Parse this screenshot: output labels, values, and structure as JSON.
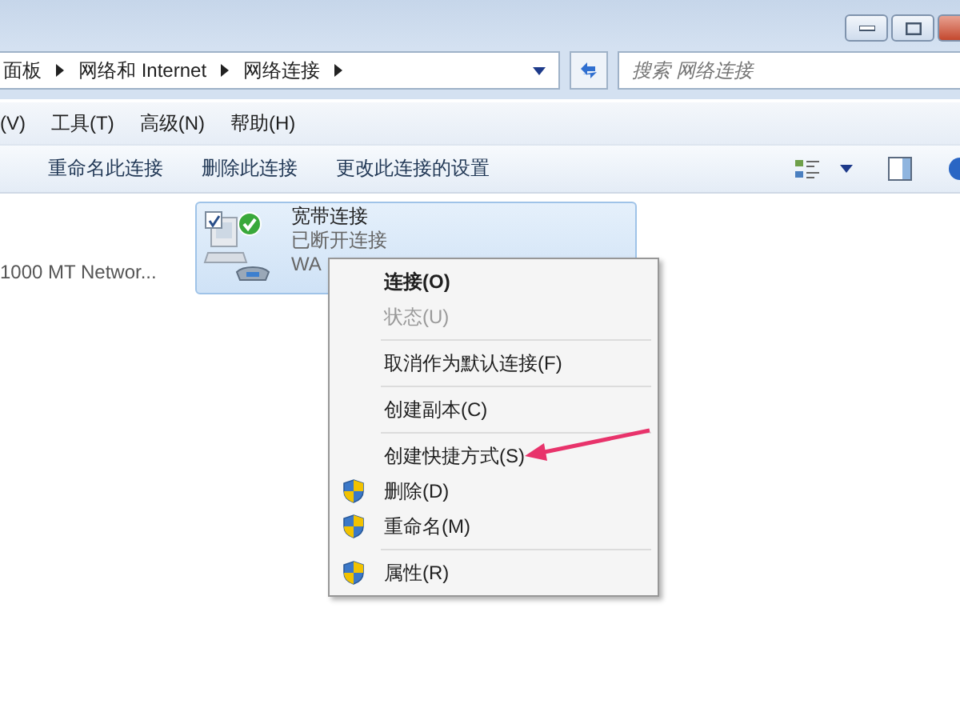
{
  "address_bar": {
    "breadcrumbs": [
      "面板",
      "网络和 Internet",
      "网络连接"
    ]
  },
  "search": {
    "placeholder": "搜索 网络连接"
  },
  "menu_bar": [
    "(V)",
    "工具(T)",
    "高级(N)",
    "帮助(H)"
  ],
  "toolbar": [
    "重命名此连接",
    "删除此连接",
    "更改此连接的设置"
  ],
  "connections": [
    {
      "kind": "text",
      "name": "1000 MT Networ..."
    },
    {
      "kind": "tile",
      "name": "宽带连接",
      "status": "已断开连接",
      "device": "WA",
      "selected": true,
      "checked": true
    }
  ],
  "context_menu": [
    {
      "kind": "item",
      "label": "连接(O)",
      "default": true,
      "disabled": false
    },
    {
      "kind": "item",
      "label": "状态(U)",
      "default": false,
      "disabled": true
    },
    {
      "kind": "separator"
    },
    {
      "kind": "item",
      "label": "取消作为默认连接(F)",
      "default": false,
      "disabled": false
    },
    {
      "kind": "separator"
    },
    {
      "kind": "item",
      "label": "创建副本(C)",
      "default": false,
      "disabled": false
    },
    {
      "kind": "separator"
    },
    {
      "kind": "item",
      "label": "创建快捷方式(S)",
      "default": false,
      "disabled": false
    },
    {
      "kind": "shield_item",
      "label": "删除(D)",
      "default": false,
      "disabled": false
    },
    {
      "kind": "shield_item",
      "label": "重命名(M)",
      "default": false,
      "disabled": false
    },
    {
      "kind": "separator"
    },
    {
      "kind": "shield_item",
      "label": "属性(R)",
      "default": false,
      "disabled": false
    }
  ]
}
